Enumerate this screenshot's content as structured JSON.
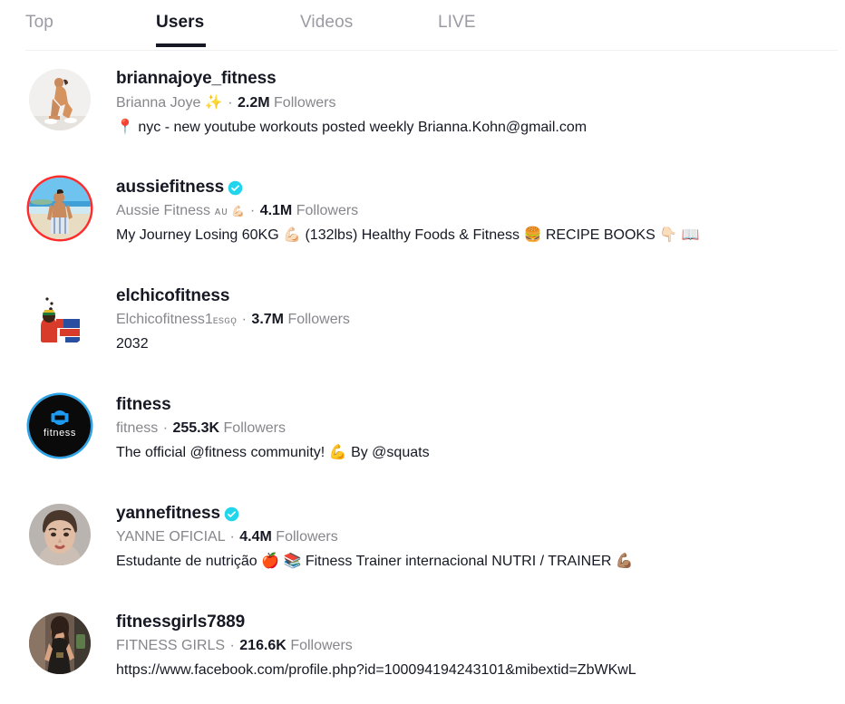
{
  "tabs": [
    {
      "label": "Top",
      "active": false,
      "name": "tab-top"
    },
    {
      "label": "Users",
      "active": true,
      "name": "tab-users"
    },
    {
      "label": "Videos",
      "active": false,
      "name": "tab-videos"
    },
    {
      "label": "LIVE",
      "active": false,
      "name": "tab-live"
    }
  ],
  "colors": {
    "accent_verified": "#20d5ec",
    "text_primary": "#161823",
    "text_secondary": "#86868b",
    "ring_red": "#ff2c2c",
    "ring_blue": "#2ba3e8",
    "divider": "#f0f0f1"
  },
  "results": [
    {
      "username": "briannajoye_fitness",
      "verified": false,
      "display_name": "Brianna Joye",
      "name_emoji": "✨",
      "separator": "·",
      "followers_count": "2.2M",
      "followers_label": "Followers",
      "description": "📍 nyc - new youtube workouts posted weekly Brianna.Kohn@gmail.com",
      "avatar_ring": "none",
      "avatar_kind": "photo-woman-lunge"
    },
    {
      "username": "aussiefitness",
      "verified": true,
      "display_name": "Aussie Fitness",
      "name_emoji": "ᴀᴜ 💪🏻",
      "separator": "·",
      "followers_count": "4.1M",
      "followers_label": "Followers",
      "description": "My Journey Losing 60KG 💪🏻 (132lbs) Healthy Foods & Fitness 🍔 RECIPE BOOKS 👇🏻 📖",
      "avatar_ring": "red",
      "avatar_kind": "photo-man-beach"
    },
    {
      "username": "elchicofitness",
      "verified": false,
      "display_name": "Elchicofitness1",
      "name_emoji": "ᴇsɢǫ",
      "separator": "·",
      "followers_count": "3.7M",
      "followers_label": "Followers",
      "description": "2032",
      "avatar_ring": "none",
      "avatar_kind": "photo-cartoon-logo"
    },
    {
      "username": "fitness",
      "verified": false,
      "display_name": "fitness",
      "name_emoji": "",
      "separator": "·",
      "followers_count": "255.3K",
      "followers_label": "Followers",
      "description": "The official @fitness community! 💪 By @squats",
      "avatar_ring": "blue",
      "avatar_kind": "logo-fitness-dumbbell"
    },
    {
      "username": "yannefitness",
      "verified": true,
      "display_name": "YANNE OFICIAL",
      "name_emoji": "",
      "separator": "·",
      "followers_count": "4.4M",
      "followers_label": "Followers",
      "description": "Estudante de nutrição 🍎 📚 Fitness Trainer internacional NUTRI / TRAINER 💪🏽",
      "avatar_ring": "none",
      "avatar_kind": "photo-woman-portrait"
    },
    {
      "username": "fitnessgirls7889",
      "verified": false,
      "display_name": "FITNESS GIRLS",
      "name_emoji": "",
      "separator": "·",
      "followers_count": "216.6K",
      "followers_label": "Followers",
      "description": "https://www.facebook.com/profile.php?id=100094194243101&mibextid=ZbWKwL",
      "avatar_ring": "none",
      "avatar_kind": "photo-woman-gym"
    }
  ]
}
